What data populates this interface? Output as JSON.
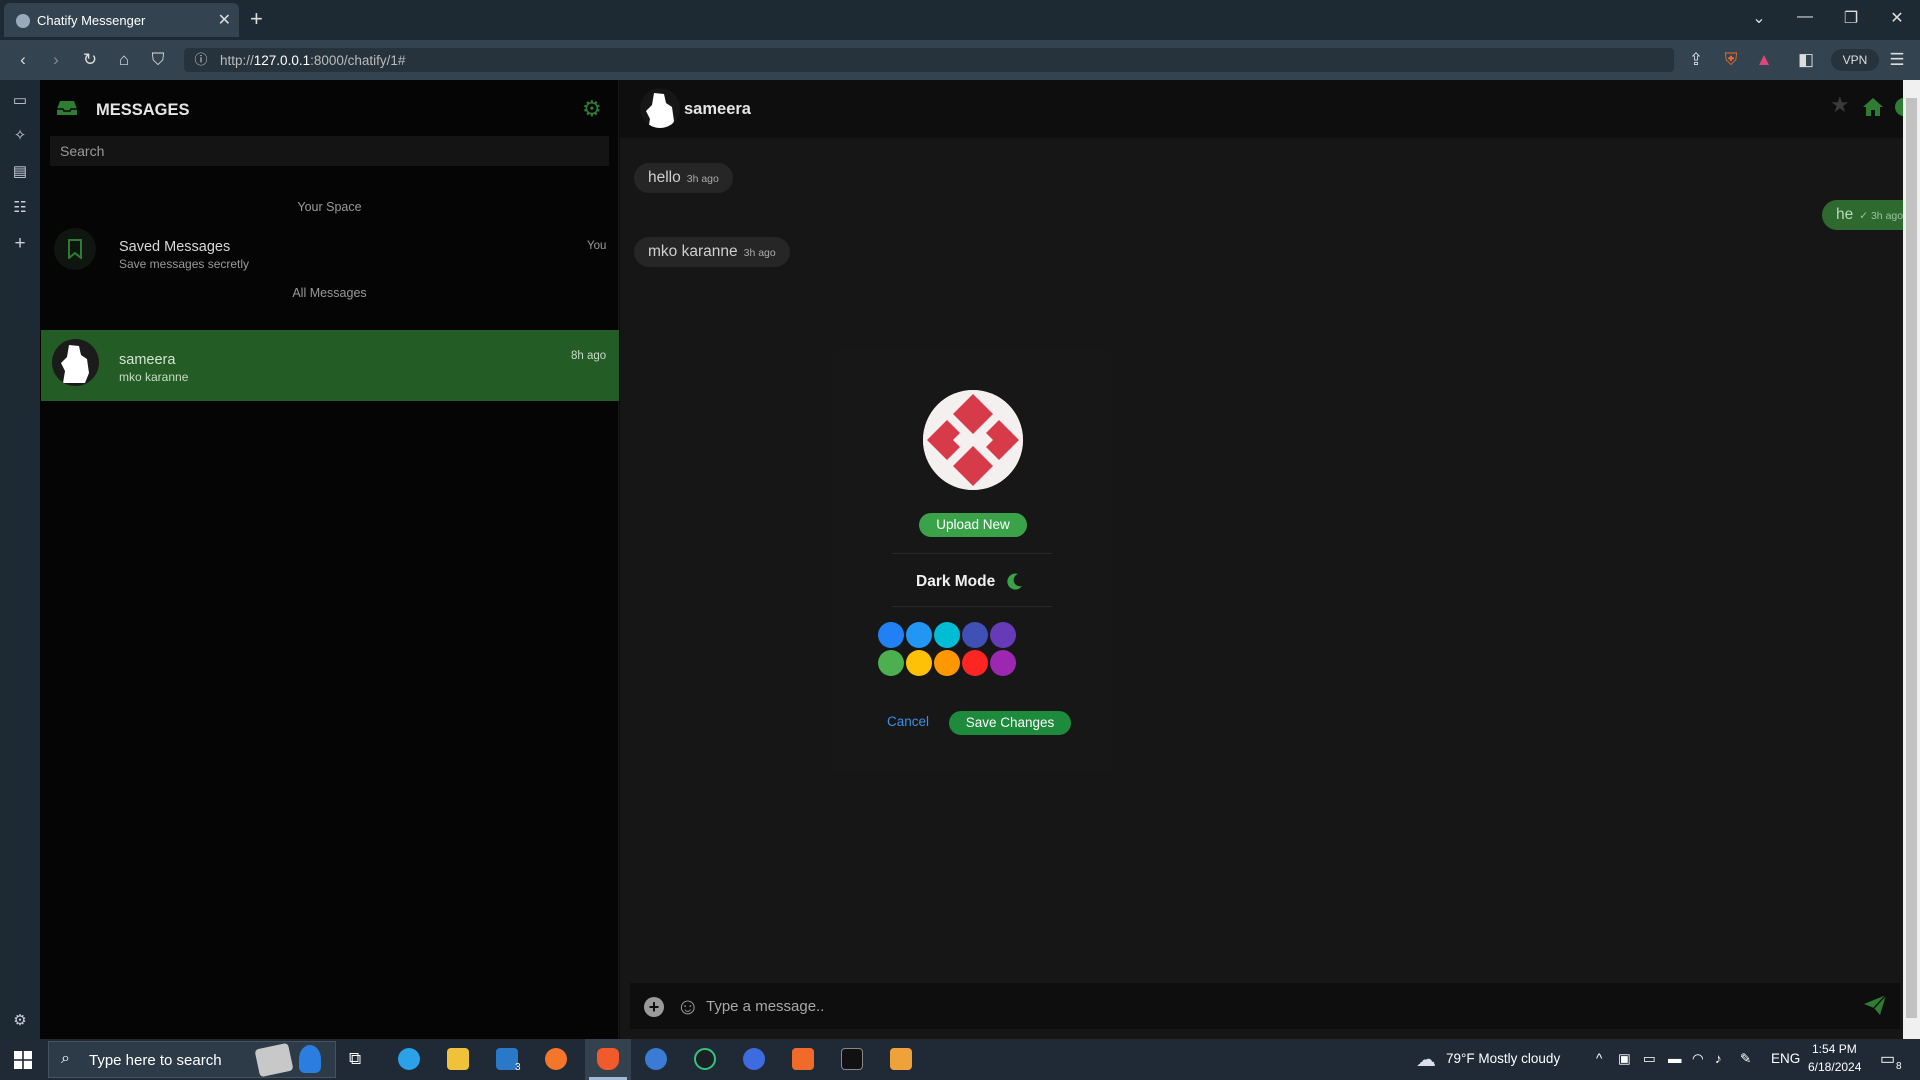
{
  "browser": {
    "tab_title": "Chatify Messenger",
    "url_prefix": "http://",
    "url_host": "127.0.0.1",
    "url_rest": ":8000/chatify/1#",
    "vpn_label": "VPN"
  },
  "list": {
    "title": "MESSAGES",
    "search_placeholder": "Search",
    "section_your_space": "Your Space",
    "saved_name": "Saved Messages",
    "saved_sub": "Save messages secretly",
    "saved_time": "You",
    "section_all": "All Messages",
    "contact_name": "sameera",
    "contact_last": "mko karanne",
    "contact_time": "8h ago"
  },
  "chat": {
    "contact_name": "sameera",
    "messages": [
      {
        "text": "hello",
        "time": "3h ago",
        "dir": "in"
      },
      {
        "text": "he",
        "time": "3h ago",
        "dir": "out"
      },
      {
        "text": "mko karanne",
        "time": "3h ago",
        "dir": "in"
      }
    ],
    "input_placeholder": "Type a message.."
  },
  "modal": {
    "upload_label": "Upload New",
    "dark_mode_label": "Dark Mode",
    "colors": [
      "#2180f3",
      "#2196f3",
      "#00bcd4",
      "#3f51b5",
      "#673ab7",
      "#4caf50",
      "#ffc107",
      "#ff9800",
      "#ff2522",
      "#9c27b0"
    ],
    "cancel_label": "Cancel",
    "save_label": "Save Changes"
  },
  "taskbar": {
    "search_placeholder": "Type here to search",
    "weather": "79°F  Mostly cloudy",
    "language": "ENG",
    "time": "1:54 PM",
    "date": "6/18/2024",
    "mail_badge": "3",
    "notif_badge": "8"
  },
  "colors": {
    "accent_green": "#2e6a30",
    "active_row": "#235c24",
    "button_green": "#1e8a3c"
  }
}
